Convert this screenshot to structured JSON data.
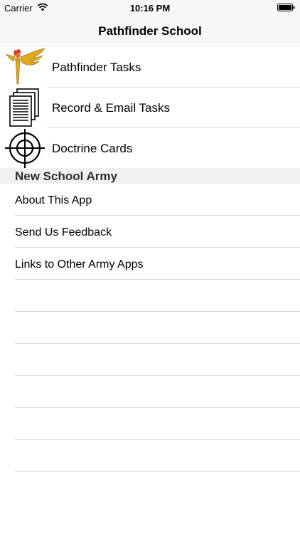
{
  "status_bar": {
    "carrier": "Carrier",
    "time": "10:16 PM"
  },
  "nav": {
    "title": "Pathfinder School"
  },
  "menu": [
    {
      "label": "Pathfinder Tasks",
      "icon": "pathfinder-badge-icon"
    },
    {
      "label": "Record & Email Tasks",
      "icon": "documents-icon"
    },
    {
      "label": "Doctrine Cards",
      "icon": "crosshair-icon"
    }
  ],
  "section": {
    "title": "New School Army"
  },
  "links": [
    {
      "label": "About This App"
    },
    {
      "label": "Send Us Feedback"
    },
    {
      "label": "Links to Other Army Apps"
    }
  ],
  "colors": {
    "bar_background": "#f7f7f7",
    "separator": "#dcdcdc",
    "section_background": "#f1f1f1",
    "badge_gold": "#e0a81c",
    "badge_red": "#d23b2a"
  }
}
